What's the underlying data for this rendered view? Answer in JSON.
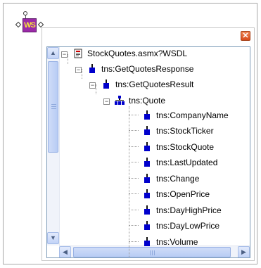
{
  "node_badge": "WS",
  "tree": {
    "root": "StockQuotes.asmx?WSDL",
    "response": "tns:GetQuotesResponse",
    "result": "tns:GetQuotesResult",
    "quote": "tns:Quote",
    "fields": [
      "tns:CompanyName",
      "tns:StockTicker",
      "tns:StockQuote",
      "tns:LastUpdated",
      "tns:Change",
      "tns:OpenPrice",
      "tns:DayHighPrice",
      "tns:DayLowPrice",
      "tns:Volume"
    ]
  },
  "colors": {
    "accent": "#0000cc",
    "badge": "#9b2aa8",
    "close": "#d84a1a"
  },
  "icons": {
    "close": "close-icon",
    "scroll_up": "chevron-up-icon",
    "scroll_down": "chevron-down-icon",
    "scroll_left": "chevron-left-icon",
    "scroll_right": "chevron-right-icon"
  }
}
